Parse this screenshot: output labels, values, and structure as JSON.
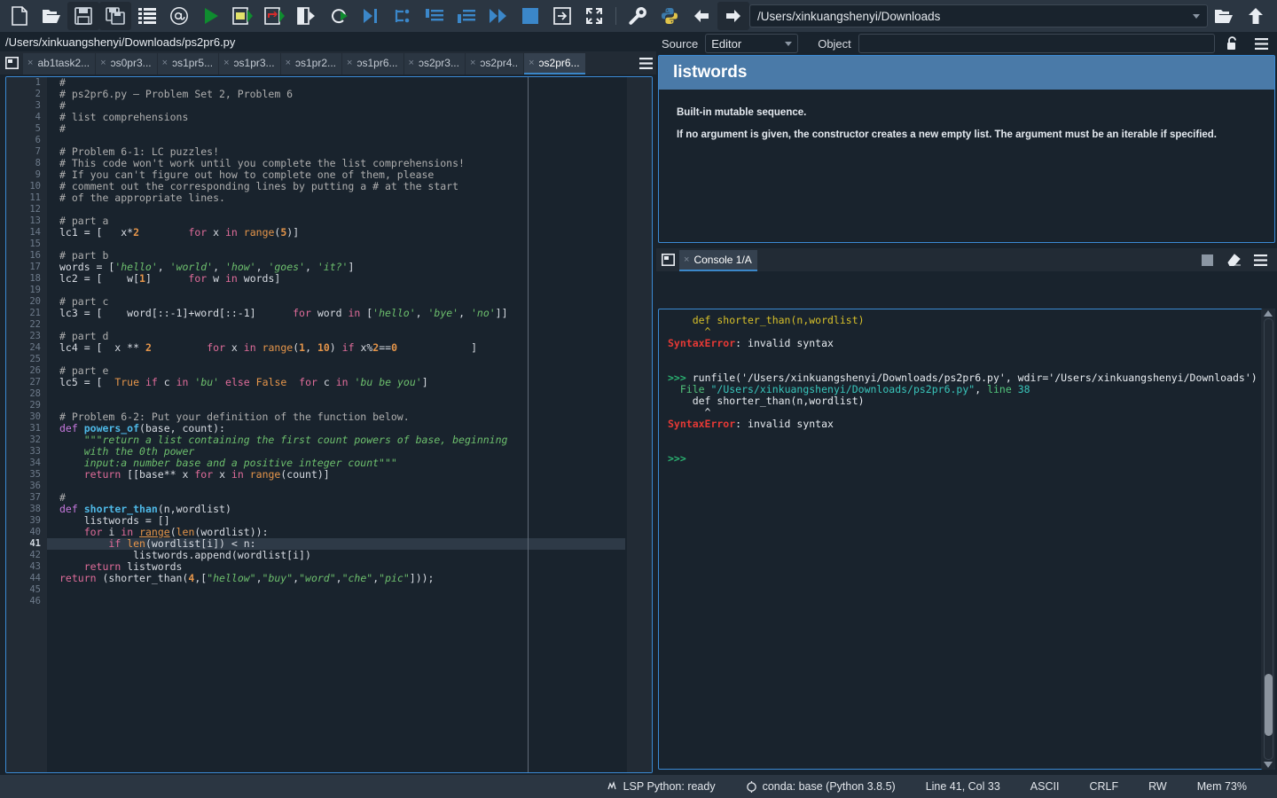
{
  "toolbar": {
    "buttons": [
      {
        "name": "new-file-icon",
        "label": "New file"
      },
      {
        "name": "open-file-icon",
        "label": "Open file"
      },
      {
        "name": "save-file-icon",
        "label": "Save file"
      },
      {
        "name": "save-all-icon",
        "label": "Save all"
      },
      {
        "name": "file-switcher-icon",
        "label": "File switcher"
      },
      {
        "name": "find-symbols-icon",
        "label": "Find symbols"
      },
      {
        "name": "run-file-icon",
        "label": "Run file"
      },
      {
        "name": "run-cell-icon",
        "label": "Run cell"
      },
      {
        "name": "run-cell-advance-icon",
        "label": "Run cell and advance"
      },
      {
        "name": "run-selection-icon",
        "label": "Run selection"
      },
      {
        "name": "re-run-icon",
        "label": "Re-run last cell"
      },
      {
        "name": "debug-file-icon",
        "label": "Debug file"
      },
      {
        "name": "step-over-icon",
        "label": "Step over"
      },
      {
        "name": "step-into-icon",
        "label": "Step into"
      },
      {
        "name": "step-return-icon",
        "label": "Step return"
      },
      {
        "name": "continue-icon",
        "label": "Continue"
      },
      {
        "name": "stop-debug-icon",
        "label": "Stop debugging"
      },
      {
        "name": "maximize-pane-icon",
        "label": "Maximize current pane"
      },
      {
        "name": "fullscreen-icon",
        "label": "Fullscreen mode"
      },
      {
        "name": "preferences-icon",
        "label": "Preferences"
      }
    ],
    "python_icon": "python-logo-icon",
    "back_icon": "back-arrow-icon",
    "forward_icon": "forward-arrow-icon",
    "path_value": "/Users/xinkuangshenyi/Downloads",
    "browse_icon": "browse-folder-icon",
    "parent_icon": "parent-directory-icon"
  },
  "editor": {
    "filepath": "/Users/xinkuangshenyi/Downloads/ps2pr6.py",
    "browse_tabs_icon": "browse-tabs-icon",
    "options_icon": "options-menu-icon",
    "tabs": [
      {
        "label": "ab1task2...",
        "active": false
      },
      {
        "label": "ɔs0pr3...",
        "active": false
      },
      {
        "label": "ɔs1pr5...",
        "active": false
      },
      {
        "label": "ɔs1pr3...",
        "active": false
      },
      {
        "label": "ɔs1pr2...",
        "active": false
      },
      {
        "label": "ɔs1pr6...",
        "active": false
      },
      {
        "label": "ɔs2pr3...",
        "active": false
      },
      {
        "label": "ɔs2pr4..",
        "active": false
      },
      {
        "label": "ɔs2pr6...",
        "active": true
      }
    ],
    "close_glyph": "×",
    "current_line": 41,
    "total_lines": 46,
    "lines": [
      {
        "n": 1,
        "html": "<span class='cmt'>#</span>"
      },
      {
        "n": 2,
        "html": "<span class='cmt'># ps2pr6.py — Problem Set 2, Problem 6</span>"
      },
      {
        "n": 3,
        "html": "<span class='cmt'>#</span>"
      },
      {
        "n": 4,
        "html": "<span class='cmt'># list comprehensions</span>"
      },
      {
        "n": 5,
        "html": "<span class='cmt'>#</span>"
      },
      {
        "n": 6,
        "html": ""
      },
      {
        "n": 7,
        "html": "<span class='cmt'># Problem 6‑1: LC puzzles!</span>"
      },
      {
        "n": 8,
        "html": "<span class='cmt'># This code won't work until you complete the list comprehensions!</span>"
      },
      {
        "n": 9,
        "html": "<span class='cmt'># If you can't figure out how to complete one of them, please</span>"
      },
      {
        "n": 10,
        "html": "<span class='cmt'># comment out the corresponding lines by putting a # at the start</span>"
      },
      {
        "n": 11,
        "html": "<span class='cmt'># of the appropriate lines.</span>"
      },
      {
        "n": 12,
        "html": ""
      },
      {
        "n": 13,
        "html": "<span class='cmt'># part a</span>"
      },
      {
        "n": 14,
        "html": "lc1 = [   x<span class='op'>*</span><span class='num'>2</span>        <span class='kw2'>for</span> x <span class='kw2'>in</span> <span class='bi'>range</span>(<span class='num'>5</span>)]"
      },
      {
        "n": 15,
        "html": ""
      },
      {
        "n": 16,
        "html": "<span class='cmt'># part b</span>"
      },
      {
        "n": 17,
        "html": "words = [<span class='str'>'hello'</span>, <span class='str'>'world'</span>, <span class='str'>'how'</span>, <span class='str'>'goes'</span>, <span class='str'>'it?'</span>]"
      },
      {
        "n": 18,
        "html": "lc2 = [    w[<span class='num'>1</span>]      <span class='kw2'>for</span> w <span class='kw2'>in</span> words]"
      },
      {
        "n": 19,
        "html": ""
      },
      {
        "n": 20,
        "html": "<span class='cmt'># part c</span>"
      },
      {
        "n": 21,
        "html": "lc3 = [    word[::‑1]+word[::‑1]      <span class='kw2'>for</span> word <span class='kw2'>in</span> [<span class='str'>'hello'</span>, <span class='str'>'bye'</span>, <span class='str'>'no'</span>]]"
      },
      {
        "n": 22,
        "html": ""
      },
      {
        "n": 23,
        "html": "<span class='cmt'># part d</span>"
      },
      {
        "n": 24,
        "html": "lc4 = [  x <span class='op'>**</span> <span class='num'>2</span>         <span class='kw2'>for</span> x <span class='kw2'>in</span> <span class='bi'>range</span>(<span class='num'>1</span>, <span class='num'>10</span>) <span class='kw2'>if</span> x%<span class='num'>2</span>==<span class='num'>0</span>            ]"
      },
      {
        "n": 25,
        "html": ""
      },
      {
        "n": 26,
        "html": "<span class='cmt'># part e</span>"
      },
      {
        "n": 27,
        "html": "lc5 = [  <span class='bi'>True</span> <span class='kw2'>if</span> c <span class='kw2'>in</span> <span class='str'>'bu'</span> <span class='kw2'>else</span> <span class='bi'>False</span>  <span class='kw2'>for</span> c <span class='kw2'>in</span> <span class='str'>'bu be you'</span>]"
      },
      {
        "n": 28,
        "html": ""
      },
      {
        "n": 29,
        "html": ""
      },
      {
        "n": 30,
        "html": "<span class='cmt'># Problem 6‑2: Put your definition of the function below.</span>"
      },
      {
        "n": 31,
        "html": "<span class='kw'>def</span> <span class='fn'>powers_of</span>(base, count):"
      },
      {
        "n": 32,
        "html": "    <span class='str'>\"\"\"return a list containing the first count powers of base, beginning</span>"
      },
      {
        "n": 33,
        "html": "    <span class='str'>with the 0th power</span>"
      },
      {
        "n": 34,
        "html": "    <span class='str'>input:a number base and a positive integer count\"\"\"</span>"
      },
      {
        "n": 35,
        "html": "    <span class='kw2'>return</span> [[base<span class='op'>**</span> x <span class='kw2'>for</span> x <span class='kw2'>in</span> <span class='bi'>range</span>(count)]"
      },
      {
        "n": 36,
        "html": ""
      },
      {
        "n": 37,
        "html": "<span class='cmt'>#</span>"
      },
      {
        "n": 38,
        "html": "<span class='kw'>def</span> <span class='fn'>shorter_than</span>(n,wordlist)"
      },
      {
        "n": 39,
        "html": "    listwords = []"
      },
      {
        "n": 40,
        "html": "    <span class='kw2'>for</span> i <span class='kw2'>in</span> <span class='bi us'>range</span>(<span class='bi'>len</span>(wordlist)):"
      },
      {
        "n": 41,
        "html": "        <span class='kw2'>if</span> <span class='bi'>len</span>(wordlist[i]) &lt; n:"
      },
      {
        "n": 42,
        "html": "            listwords.append(wordlist[i])"
      },
      {
        "n": 43,
        "html": "    <span class='kw2'>return</span> listwords"
      },
      {
        "n": 44,
        "html": "<span class='kw2'>return</span> (shorter_than(<span class='num'>4</span>,[<span class='str'>\"hellow\"</span>,<span class='str'>\"buy\"</span>,<span class='str'>\"word\"</span>,<span class='str'>\"che\"</span>,<span class='str'>\"pic\"</span>]));"
      },
      {
        "n": 45,
        "html": ""
      },
      {
        "n": 46,
        "html": ""
      }
    ]
  },
  "help": {
    "source_label": "Source",
    "source_value": "Editor",
    "object_label": "Object",
    "object_value": "",
    "object_placeholder": "",
    "lock_icon": "unlock-icon",
    "options_icon": "options-menu-icon",
    "title": "listwords",
    "paragraphs": [
      "Built-in mutable sequence.",
      "If no argument is given, the constructor creates a new empty list. The argument must be an iterable if specified."
    ]
  },
  "console": {
    "browse_tabs_icon": "browse-tabs-icon",
    "tab_label": "Console 1/A",
    "close_glyph": "×",
    "stop_icon": "stop-icon",
    "clear_icon": "eraser-icon",
    "options_icon": "options-menu-icon",
    "lines": [
      {
        "html": "<span class='yel'>    def shorter_than(n,wordlist)</span>"
      },
      {
        "html": "<span class='yel'>      ^</span>"
      },
      {
        "html": "<span class='err'>SyntaxError</span><span class='white'>: invalid syntax</span>"
      },
      {
        "html": ""
      },
      {
        "html": ""
      },
      {
        "html": "<span class='prompt'>&gt;&gt;&gt;</span> <span class='white'>runfile('/Users/xinkuangshenyi/Downloads/ps2pr6.py', wdir='/Users/xinkuangshenyi/Downloads')</span>"
      },
      {
        "html": "  <span class='grn'>File </span><span class='cyan'>\"/Users/xinkuangshenyi/Downloads/ps2pr6.py\"</span><span class='white'>, </span><span class='grn'>line </span><span class='cyan'>38</span>"
      },
      {
        "html": "    <span class='white'>def shorter_than(n,wordlist)</span>"
      },
      {
        "html": "      <span class='white'>^</span>"
      },
      {
        "html": "<span class='err'>SyntaxError</span><span class='white'>: invalid syntax</span>"
      },
      {
        "html": ""
      },
      {
        "html": ""
      },
      {
        "html": "<span class='prompt'>&gt;&gt;&gt;</span>"
      }
    ]
  },
  "status": {
    "items": [
      {
        "icon": "lsp-icon",
        "text": "LSP Python: ready"
      },
      {
        "icon": "conda-icon",
        "text": "conda: base (Python 3.8.5)"
      },
      {
        "icon": "",
        "text": "Line 41, Col 33"
      },
      {
        "icon": "",
        "text": "ASCII"
      },
      {
        "icon": "",
        "text": "CRLF"
      },
      {
        "icon": "",
        "text": "RW"
      },
      {
        "icon": "",
        "text": "Mem 73%"
      }
    ]
  },
  "colors": {
    "accent": "#3b8ad4",
    "chrome": "#2b3642",
    "panel": "#19232d",
    "tabbar": "#222b35",
    "help_header": "#4a7aa8",
    "error": "#e53935",
    "prompt_green": "#2bb673"
  }
}
